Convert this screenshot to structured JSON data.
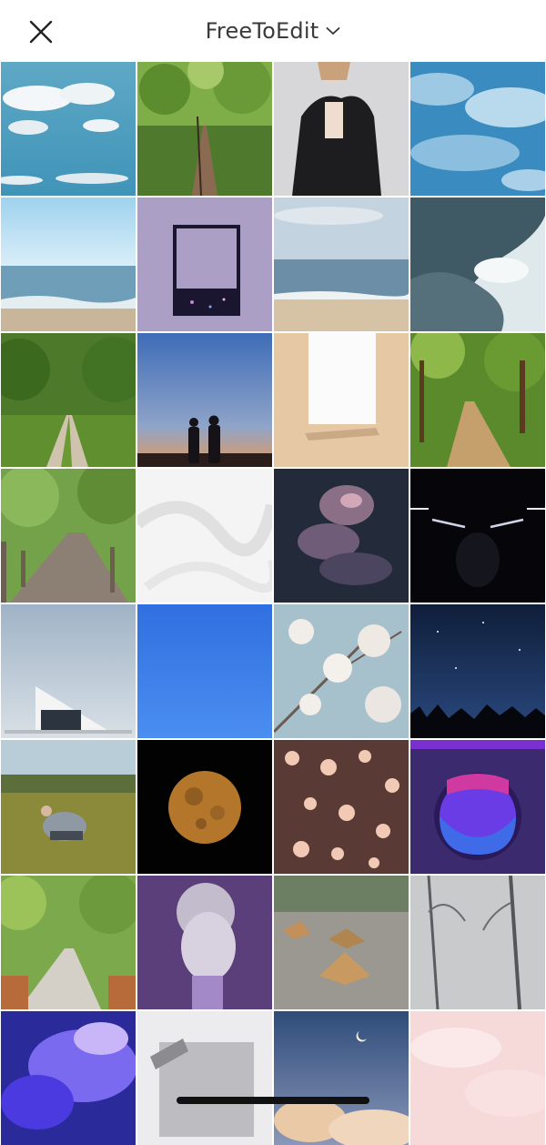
{
  "header": {
    "title": "FreeToEdit",
    "close_icon": "close-icon",
    "dropdown_icon": "chevron-down-icon"
  },
  "grid": {
    "columns": 4,
    "tiles": [
      {
        "subject": "sky-clouds"
      },
      {
        "subject": "forest-road"
      },
      {
        "subject": "woman-black-dress"
      },
      {
        "subject": "blue-sky-clouds"
      },
      {
        "subject": "sea-horizon"
      },
      {
        "subject": "polaroid-frame-lilac"
      },
      {
        "subject": "beach-shore"
      },
      {
        "subject": "ocean-waves"
      },
      {
        "subject": "country-lane"
      },
      {
        "subject": "couple-silhouette-sunset"
      },
      {
        "subject": "blank-paper-on-wood"
      },
      {
        "subject": "forest-trail"
      },
      {
        "subject": "wooden-boardwalk"
      },
      {
        "subject": "white-fabric"
      },
      {
        "subject": "night-clouds"
      },
      {
        "subject": "dark-light-streaks"
      },
      {
        "subject": "modern-building"
      },
      {
        "subject": "plain-blue-sky"
      },
      {
        "subject": "white-blossoms"
      },
      {
        "subject": "starry-night-trees"
      },
      {
        "subject": "man-resting-field"
      },
      {
        "subject": "full-moon"
      },
      {
        "subject": "heart-bokeh"
      },
      {
        "subject": "purple-dripping-circle"
      },
      {
        "subject": "tree-lined-path"
      },
      {
        "subject": "statue-head-purple"
      },
      {
        "subject": "autumn-leaves"
      },
      {
        "subject": "foggy-forest"
      },
      {
        "subject": "purple-galaxy-clouds"
      },
      {
        "subject": "paper-note-gray"
      },
      {
        "subject": "evening-clouds-moon"
      },
      {
        "subject": "pink-clouds"
      }
    ]
  },
  "colors": {
    "title_text": "#3a3a3a",
    "home_indicator": "#111111"
  }
}
